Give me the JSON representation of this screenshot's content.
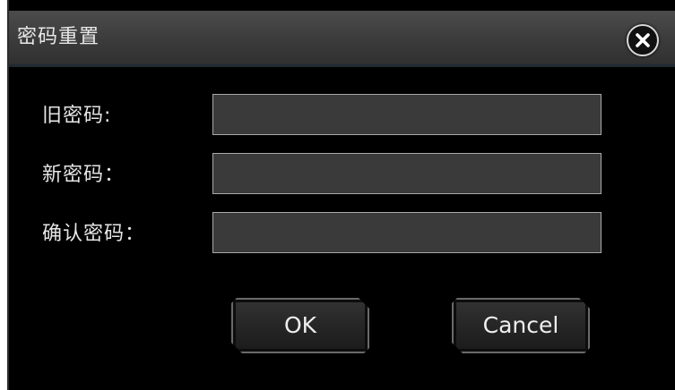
{
  "dialog": {
    "title": "密码重置",
    "close_icon": "close-icon"
  },
  "fields": [
    {
      "label": "旧密码:",
      "value": ""
    },
    {
      "label": "新密码：",
      "value": ""
    },
    {
      "label": "确认密码：",
      "value": ""
    }
  ],
  "buttons": {
    "ok_label": "OK",
    "cancel_label": "Cancel"
  },
  "colors": {
    "background": "#000000",
    "titlebar": "#3b3b3b",
    "input_background": "#3a3a3a",
    "input_border": "#a9a9a9",
    "text": "#e6e6e6"
  }
}
